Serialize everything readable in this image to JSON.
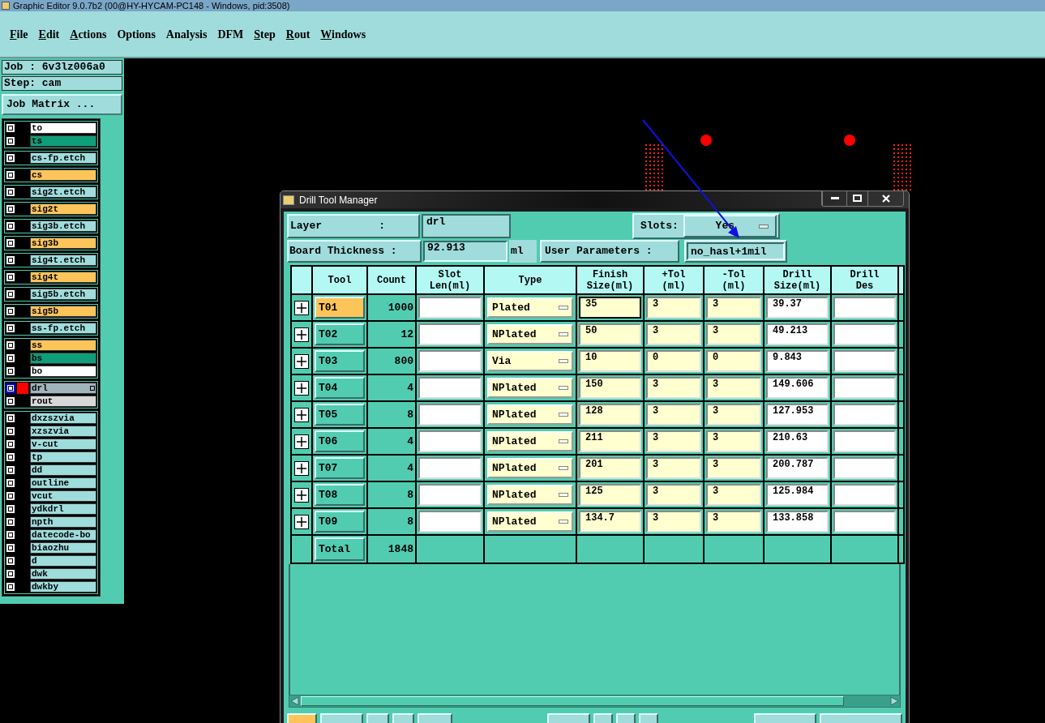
{
  "window": {
    "title": "Graphic Editor 9.0.7b2 (00@HY-HYCAM-PC148 - Windows, pid:3508)"
  },
  "menu": [
    {
      "label": "File",
      "mnemonic": true
    },
    {
      "label": "Edit",
      "mnemonic": true
    },
    {
      "label": "Actions",
      "mnemonic": true
    },
    {
      "label": "Options",
      "mnemonic": false
    },
    {
      "label": "Analysis",
      "mnemonic": false
    },
    {
      "label": "DFM",
      "mnemonic": false
    },
    {
      "label": "Step",
      "mnemonic": true
    },
    {
      "label": "Rout",
      "mnemonic": true
    },
    {
      "label": "Windows",
      "mnemonic": true
    }
  ],
  "job": "Job : 6v3lz006a0",
  "step": "Step: cam",
  "job_matrix_button": "Job Matrix ...",
  "layer_groups": [
    {
      "layers": [
        {
          "name": "to",
          "color": "#ffffff",
          "active": false
        },
        {
          "name": "ts",
          "color": "#0f9e7a",
          "active": false
        }
      ]
    },
    {
      "layers": [
        {
          "name": "cs-fp.etch",
          "color": "#9fdcdc",
          "active": false
        }
      ]
    },
    {
      "layers": [
        {
          "name": "cs",
          "color": "#fdc45a",
          "active": false
        }
      ]
    },
    {
      "layers": [
        {
          "name": "sig2t.etch",
          "color": "#9fdcdc",
          "active": false
        }
      ]
    },
    {
      "layers": [
        {
          "name": "sig2t",
          "color": "#fdc45a",
          "active": false
        }
      ]
    },
    {
      "layers": [
        {
          "name": "sig3b.etch",
          "color": "#9fdcdc",
          "active": false
        }
      ]
    },
    {
      "layers": [
        {
          "name": "sig3b",
          "color": "#fdc45a",
          "active": false
        }
      ]
    },
    {
      "layers": [
        {
          "name": "sig4t.etch",
          "color": "#9fdcdc",
          "active": false
        }
      ]
    },
    {
      "layers": [
        {
          "name": "sig4t",
          "color": "#fdc45a",
          "active": false
        }
      ]
    },
    {
      "layers": [
        {
          "name": "sig5b.etch",
          "color": "#9fdcdc",
          "active": false
        }
      ]
    },
    {
      "layers": [
        {
          "name": "sig5b",
          "color": "#fdc45a",
          "active": false
        }
      ]
    },
    {
      "layers": [
        {
          "name": "ss-fp.etch",
          "color": "#9fdcdc",
          "active": false
        }
      ]
    },
    {
      "layers": [
        {
          "name": "ss",
          "color": "#fdc45a",
          "active": false
        },
        {
          "name": "bs",
          "color": "#0f9e7a",
          "active": false
        },
        {
          "name": "bo",
          "color": "#ffffff",
          "active": false
        }
      ]
    },
    {
      "layers": [
        {
          "name": "drl",
          "color": "#a0b4bc",
          "active": true
        },
        {
          "name": "rout",
          "color": "#d8d8d8",
          "active": false
        }
      ]
    },
    {
      "layers": [
        {
          "name": "dxzszvia",
          "color": "#9fdcdc",
          "active": false
        },
        {
          "name": "xzszvia",
          "color": "#9fdcdc",
          "active": false
        },
        {
          "name": "v-cut",
          "color": "#9fdcdc",
          "active": false
        },
        {
          "name": "tp",
          "color": "#9fdcdc",
          "active": false
        },
        {
          "name": "dd",
          "color": "#9fdcdc",
          "active": false
        },
        {
          "name": "outline",
          "color": "#9fdcdc",
          "active": false
        },
        {
          "name": "vcut",
          "color": "#9fdcdc",
          "active": false
        },
        {
          "name": "ydkdrl",
          "color": "#9fdcdc",
          "active": false
        },
        {
          "name": "npth",
          "color": "#9fdcdc",
          "active": false
        },
        {
          "name": "datecode-bo",
          "color": "#9fdcdc",
          "active": false
        },
        {
          "name": "biaozhu",
          "color": "#9fdcdc",
          "active": false
        },
        {
          "name": "d",
          "color": "#9fdcdc",
          "active": false
        },
        {
          "name": "dwk",
          "color": "#9fdcdc",
          "active": false
        },
        {
          "name": "dwkby",
          "color": "#9fdcdc",
          "active": false
        }
      ]
    }
  ],
  "dialog": {
    "title": "Drill Tool Manager",
    "layer_label": "Layer         :",
    "layer_value": "drl",
    "slots_label": "Slots:",
    "slots_value": "Yes",
    "thickness_label": "Board Thickness :",
    "thickness_value": "92.913",
    "thickness_unit": "ml",
    "user_params_button": "User Parameters :",
    "user_params_value": "no_hasl+1mil",
    "columns": [
      "Tool",
      "Count",
      "Slot\nLen(ml)",
      "Type",
      "Finish\nSize(ml)",
      "+Tol\n(ml)",
      "-Tol\n(ml)",
      "Drill\nSize(ml)",
      "Drill\nDes"
    ],
    "rows": [
      {
        "tool": "T01",
        "count": "1000",
        "type": "Plated",
        "finish": "35",
        "plus_tol": "3",
        "minus_tol": "3",
        "drill_size": "39.37",
        "selected": true
      },
      {
        "tool": "T02",
        "count": "12",
        "type": "NPlated",
        "finish": "50",
        "plus_tol": "3",
        "minus_tol": "3",
        "drill_size": "49.213",
        "selected": false
      },
      {
        "tool": "T03",
        "count": "800",
        "type": "Via",
        "finish": "10",
        "plus_tol": "0",
        "minus_tol": "0",
        "drill_size": "9.843",
        "selected": false
      },
      {
        "tool": "T04",
        "count": "4",
        "type": "NPlated",
        "finish": "150",
        "plus_tol": "3",
        "minus_tol": "3",
        "drill_size": "149.606",
        "selected": false
      },
      {
        "tool": "T05",
        "count": "8",
        "type": "NPlated",
        "finish": "128",
        "plus_tol": "3",
        "minus_tol": "3",
        "drill_size": "127.953",
        "selected": false
      },
      {
        "tool": "T06",
        "count": "4",
        "type": "NPlated",
        "finish": "211",
        "plus_tol": "3",
        "minus_tol": "3",
        "drill_size": "210.63",
        "selected": false
      },
      {
        "tool": "T07",
        "count": "4",
        "type": "NPlated",
        "finish": "201",
        "plus_tol": "3",
        "minus_tol": "3",
        "drill_size": "200.787",
        "selected": false
      },
      {
        "tool": "T08",
        "count": "8",
        "type": "NPlated",
        "finish": "125",
        "plus_tol": "3",
        "minus_tol": "3",
        "drill_size": "125.984",
        "selected": false
      },
      {
        "tool": "T09",
        "count": "8",
        "type": "NPlated",
        "finish": "134.7",
        "plus_tol": "3",
        "minus_tol": "3",
        "drill_size": "133.858",
        "selected": false
      }
    ],
    "total_label": "Total",
    "total_count": "1848"
  }
}
